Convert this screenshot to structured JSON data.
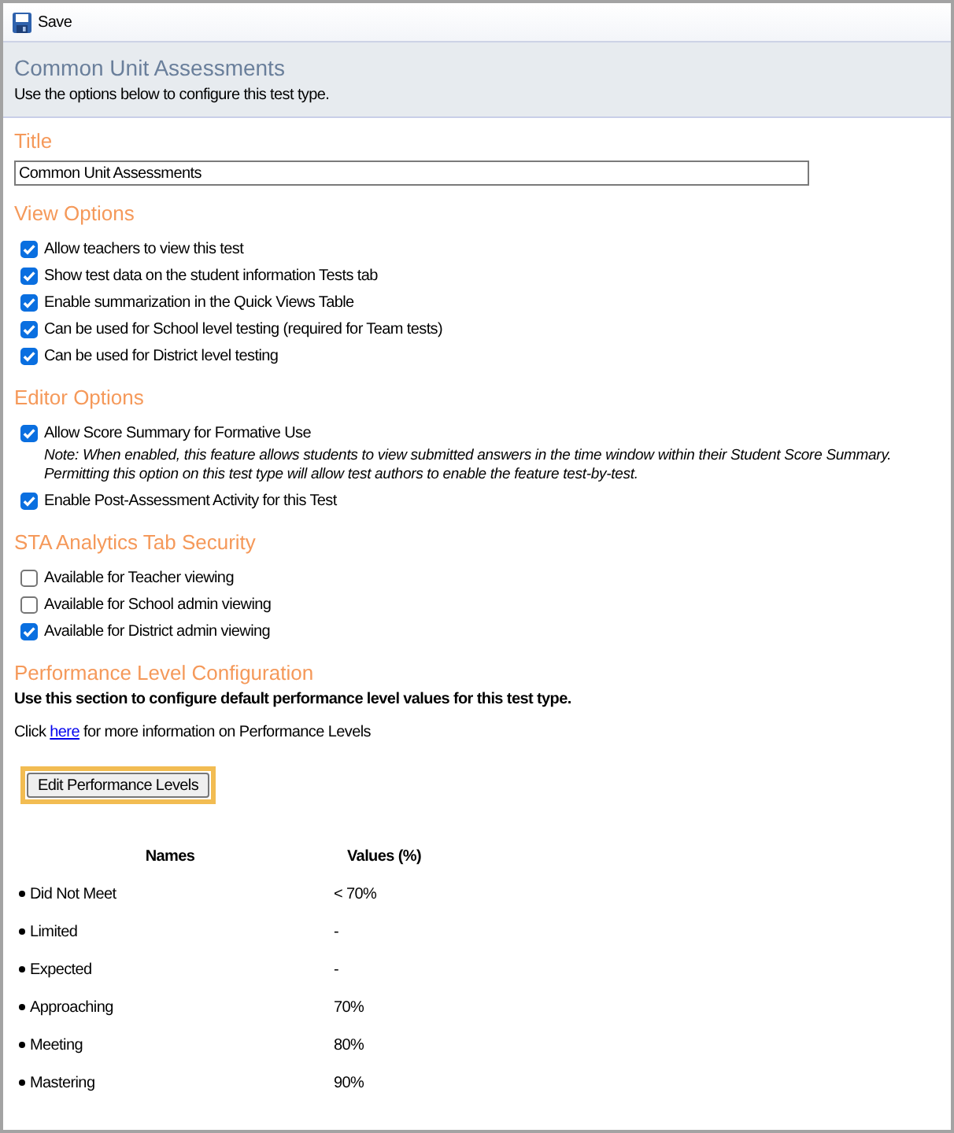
{
  "toolbar": {
    "save_button": {
      "label": "Save"
    }
  },
  "header": {
    "title": "Common Unit Assessments",
    "subtitle": "Use the options below to configure this test type."
  },
  "sections": [
    {
      "kind": "text_field",
      "heading": "Title",
      "value": "Common Unit Assessments"
    },
    {
      "kind": "checklist",
      "heading": "View Options",
      "items": [
        {
          "label": "Allow teachers to view this test",
          "checked": true
        },
        {
          "label": "Show test data on the student information Tests tab",
          "checked": true
        },
        {
          "label": "Enable summarization in the Quick Views Table",
          "checked": true
        },
        {
          "label": "Can be used for School level testing (required for Team tests)",
          "checked": true
        },
        {
          "label": "Can be used for District level testing",
          "checked": true
        }
      ]
    },
    {
      "kind": "checklist",
      "heading": "Editor Options",
      "items": [
        {
          "label": "Allow Score Summary for Formative Use",
          "checked": true,
          "note": "Note: When enabled, this feature allows students to view submitted answers in the time window within their Student Score Summary. Permitting this option on this test type will allow test authors to enable the feature test-by-test."
        },
        {
          "label": "Enable Post-Assessment Activity for this Test",
          "checked": true
        }
      ]
    },
    {
      "kind": "checklist",
      "heading": "STA Analytics Tab Security",
      "items": [
        {
          "label": "Available for Teacher viewing",
          "checked": false
        },
        {
          "label": "Available for School admin viewing",
          "checked": false
        },
        {
          "label": "Available for District admin viewing",
          "checked": true
        }
      ]
    },
    {
      "kind": "performance",
      "heading": "Performance Level Configuration",
      "description": "Use this section to configure default performance level values for this test type.",
      "info": {
        "before": "Click",
        "link": "here",
        "after": "for more information on Performance Levels"
      },
      "button": {
        "label": "Edit Performance Levels",
        "highlighted": true
      },
      "table": {
        "columns": [
          "Names",
          "Values (%)"
        ],
        "rows": [
          {
            "name": "Did Not Meet",
            "value": "< 70%"
          },
          {
            "name": "Limited",
            "value": "-"
          },
          {
            "name": "Expected",
            "value": "-"
          },
          {
            "name": "Approaching",
            "value": "70%"
          },
          {
            "name": "Meeting",
            "value": "80%"
          },
          {
            "name": "Mastering",
            "value": "90%"
          }
        ]
      }
    }
  ]
}
